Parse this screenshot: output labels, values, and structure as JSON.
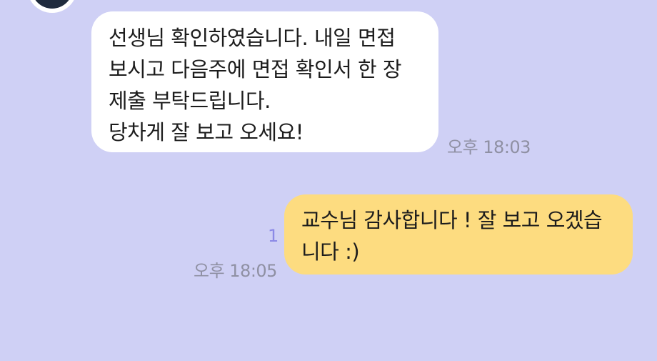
{
  "chat": {
    "incoming": {
      "lines": [
        "선생님 확인하였습니다. 내일 면접",
        "보시고 다음주에 면접 확인서 한 장",
        "제출 부탁드립니다.",
        "당차게 잘 보고 오세요!"
      ],
      "time": "오후 18:03"
    },
    "outgoing": {
      "lines": [
        "교수님 감사합니다 ! 잘 보고 오겠습",
        "니다 :)"
      ],
      "time": "오후 18:05",
      "unread_count": "1"
    }
  },
  "colors": {
    "background": "#cfd0f5",
    "incoming_bubble": "#ffffff",
    "outgoing_bubble": "#fddc80",
    "unread": "#8b89e6",
    "timestamp": "#8f90a3"
  }
}
